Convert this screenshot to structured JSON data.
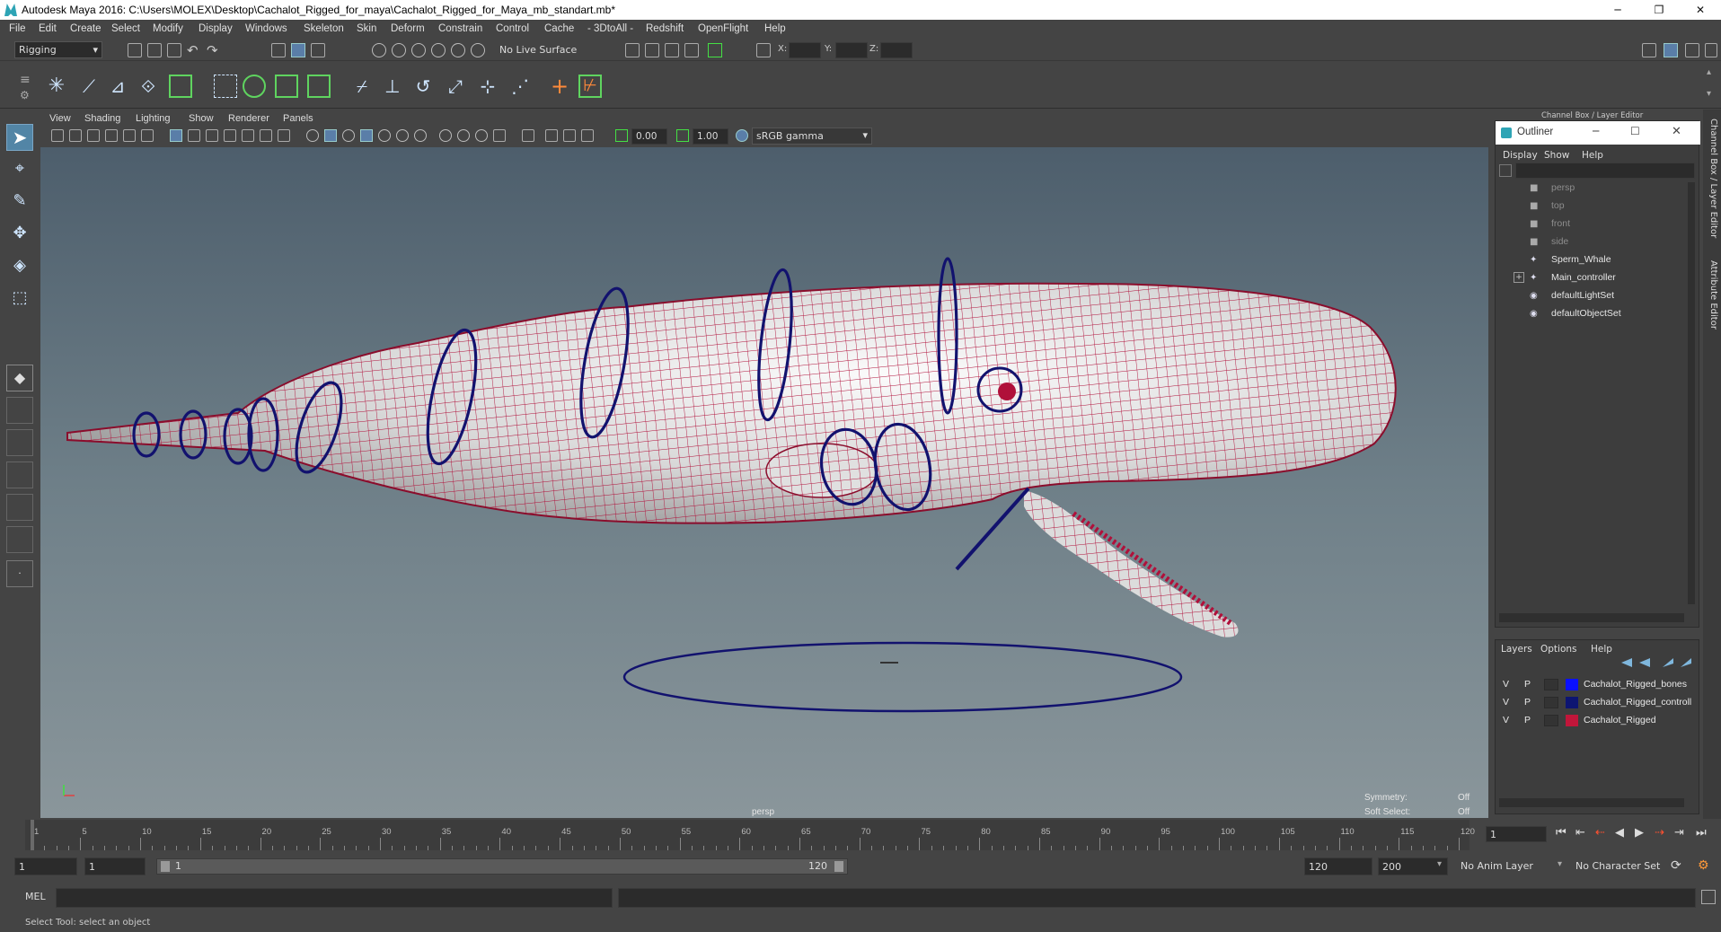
{
  "window": {
    "title": "Autodesk Maya 2016: C:\\Users\\MOLEX\\Desktop\\Cachalot_Rigged_for_maya\\Cachalot_Rigged_for_Maya_mb_standart.mb*",
    "minimize": "─",
    "maximize": "❐",
    "close": "✕"
  },
  "menus": [
    "File",
    "Edit",
    "Create",
    "Select",
    "Modify",
    "Display",
    "Windows",
    "Skeleton",
    "Skin",
    "Deform",
    "Constrain",
    "Control",
    "Cache",
    "- 3DtoAll -",
    "Redshift",
    "OpenFlight",
    "Help"
  ],
  "status": {
    "mode": "Rigging",
    "live_surface": "No Live Surface",
    "x_label": "X:",
    "y_label": "Y:",
    "z_label": "Z:"
  },
  "viewport": {
    "menus": [
      "View",
      "Shading",
      "Lighting",
      "Show",
      "Renderer",
      "Panels"
    ],
    "exposure": "0.00",
    "gamma": "1.00",
    "color_space": "sRGB gamma",
    "camera": "persp",
    "symmetry_label": "Symmetry:",
    "symmetry_value": "Off",
    "soft_select_label": "Soft Select:",
    "soft_select_value": "Off",
    "wire_color": "#b0103a",
    "curve_color": "#12126e"
  },
  "right_panel": {
    "header": "Channel Box / Layer Editor",
    "tab_channel": "Channel Box / Layer Editor",
    "tab_attribute": "Attribute Editor"
  },
  "outliner": {
    "title": "Outliner",
    "menus": [
      "Display",
      "Show",
      "Help"
    ],
    "items": [
      {
        "label": "persp",
        "dim": true,
        "icon": "camera-icon"
      },
      {
        "label": "top",
        "dim": true,
        "icon": "camera-icon"
      },
      {
        "label": "front",
        "dim": true,
        "icon": "camera-icon"
      },
      {
        "label": "side",
        "dim": true,
        "icon": "camera-icon"
      },
      {
        "label": "Sperm_Whale",
        "dim": false,
        "icon": "mesh-icon"
      },
      {
        "label": "Main_controller",
        "dim": false,
        "icon": "curve-icon"
      },
      {
        "label": "defaultLightSet",
        "dim": false,
        "icon": "set-icon"
      },
      {
        "label": "defaultObjectSet",
        "dim": false,
        "icon": "set-icon"
      }
    ],
    "expand": "+"
  },
  "layers": {
    "menus": [
      "Layers",
      "Options",
      "Help"
    ],
    "rows": [
      {
        "v": "V",
        "p": "P",
        "name": "Cachalot_Rigged_bones",
        "color": "#0a10ff"
      },
      {
        "v": "V",
        "p": "P",
        "name": "Cachalot_Rigged_controll",
        "color": "#0d1572"
      },
      {
        "v": "V",
        "p": "P",
        "name": "Cachalot_Rigged",
        "color": "#c1163a"
      }
    ]
  },
  "timeline": {
    "ticks": [
      "1",
      "5",
      "10",
      "15",
      "20",
      "25",
      "30",
      "35",
      "40",
      "45",
      "50",
      "55",
      "60",
      "65",
      "70",
      "75",
      "80",
      "85",
      "90",
      "95",
      "100",
      "105",
      "110",
      "115",
      "120"
    ],
    "current_frame": "1"
  },
  "range": {
    "start": "1",
    "playback_start": "1",
    "slider_start": "1",
    "slider_end": "120",
    "playback_end": "120",
    "end": "200",
    "anim_layer": "No Anim Layer",
    "character_set": "No Character Set"
  },
  "command": {
    "label": "MEL",
    "help": "Select Tool: select an object"
  }
}
